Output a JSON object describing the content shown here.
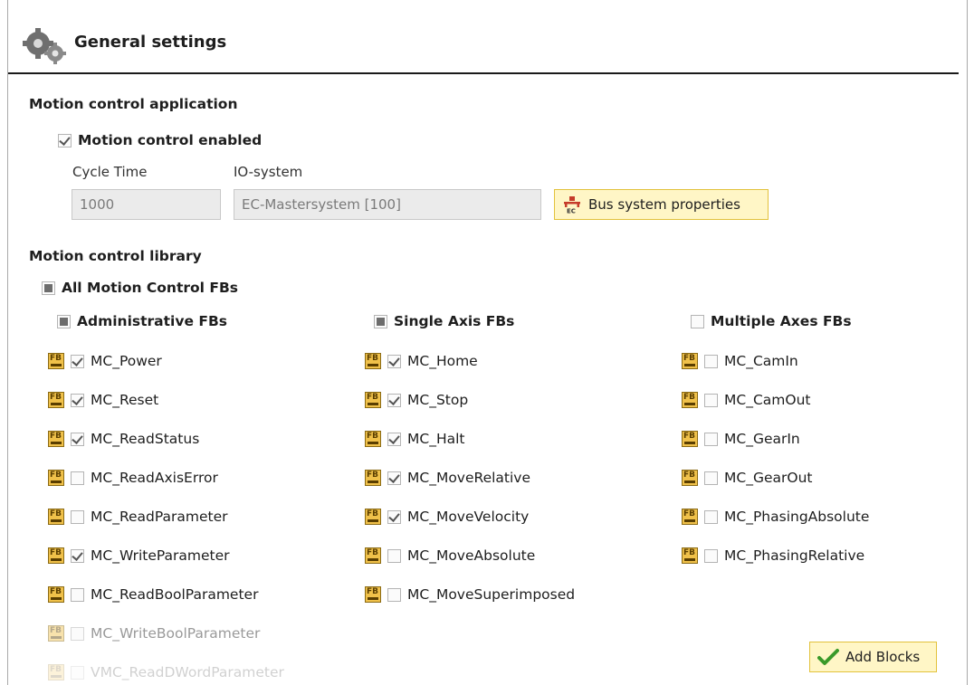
{
  "header": {
    "title": "General settings",
    "icon": "gears-icon"
  },
  "motion_app": {
    "title": "Motion control application",
    "enabled_label": "Motion control enabled",
    "enabled": true,
    "cycle_time_label": "Cycle Time",
    "cycle_time_value": "1000",
    "io_system_label": "IO-system",
    "io_system_value": "EC-Mastersystem [100]",
    "bus_button_label": "Bus system properties"
  },
  "library": {
    "title": "Motion control library",
    "all_label": "All Motion Control FBs",
    "groups": [
      {
        "label": "Administrative FBs",
        "state": "partial",
        "items": [
          {
            "label": "MC_Power",
            "checked": true
          },
          {
            "label": "MC_Reset",
            "checked": true
          },
          {
            "label": "MC_ReadStatus",
            "checked": true
          },
          {
            "label": "MC_ReadAxisError",
            "checked": false
          },
          {
            "label": "MC_ReadParameter",
            "checked": false
          },
          {
            "label": "MC_WriteParameter",
            "checked": true
          },
          {
            "label": "MC_ReadBoolParameter",
            "checked": false
          },
          {
            "label": "MC_WriteBoolParameter",
            "checked": false,
            "disabled": true
          },
          {
            "label": "VMC_ReadDWordParameter",
            "checked": false,
            "disabled": true
          }
        ]
      },
      {
        "label": "Single Axis FBs",
        "state": "partial",
        "items": [
          {
            "label": "MC_Home",
            "checked": true
          },
          {
            "label": "MC_Stop",
            "checked": true
          },
          {
            "label": "MC_Halt",
            "checked": true
          },
          {
            "label": "MC_MoveRelative",
            "checked": true
          },
          {
            "label": "MC_MoveVelocity",
            "checked": true
          },
          {
            "label": "MC_MoveAbsolute",
            "checked": false
          },
          {
            "label": "MC_MoveSuperimposed",
            "checked": false
          }
        ]
      },
      {
        "label": "Multiple Axes FBs",
        "state": "unchecked",
        "items": [
          {
            "label": "MC_CamIn",
            "checked": false
          },
          {
            "label": "MC_CamOut",
            "checked": false
          },
          {
            "label": "MC_GearIn",
            "checked": false
          },
          {
            "label": "MC_GearOut",
            "checked": false
          },
          {
            "label": "MC_PhasingAbsolute",
            "checked": false
          },
          {
            "label": "MC_PhasingRelative",
            "checked": false
          }
        ]
      }
    ]
  },
  "add_blocks_label": "Add Blocks",
  "colors": {
    "button_bg": "#fff6c6",
    "button_border": "#e2c23c",
    "check_green": "#3a9a2a"
  }
}
